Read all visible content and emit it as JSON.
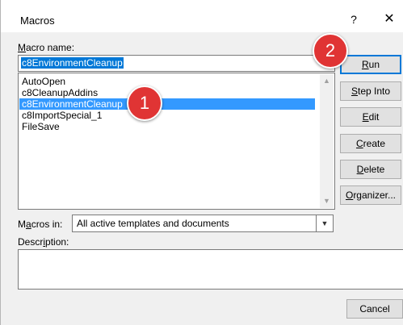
{
  "window": {
    "title": "Macros",
    "help_label": "?",
    "close_label": "✕"
  },
  "macro_name": {
    "label_u": "M",
    "label_rest": "acro name:",
    "value": "c8EnvironmentCleanup"
  },
  "macro_list": {
    "items": [
      "AutoOpen",
      "c8CleanupAddins",
      "c8EnvironmentCleanup",
      "c8ImportSpecial_1",
      "FileSave"
    ],
    "selected_index": 2
  },
  "buttons": {
    "run_u": "R",
    "run_rest": "un",
    "step_into_u": "S",
    "step_into_rest": "tep Into",
    "edit_u": "E",
    "edit_rest": "dit",
    "create_u": "C",
    "create_rest": "reate",
    "delete_u": "D",
    "delete_rest": "elete",
    "organizer_u": "O",
    "organizer_rest": "rganizer...",
    "cancel": "Cancel"
  },
  "macros_in": {
    "label_pre": "M",
    "label_u": "a",
    "label_rest": "cros in:",
    "value": "All active templates and documents"
  },
  "description": {
    "label_pre": "Descr",
    "label_u": "i",
    "label_rest": "ption:"
  },
  "badges": [
    "1",
    "2"
  ],
  "colors": {
    "badge": "#e03434",
    "selection": "#3399ff",
    "default_border": "#0078d7"
  }
}
